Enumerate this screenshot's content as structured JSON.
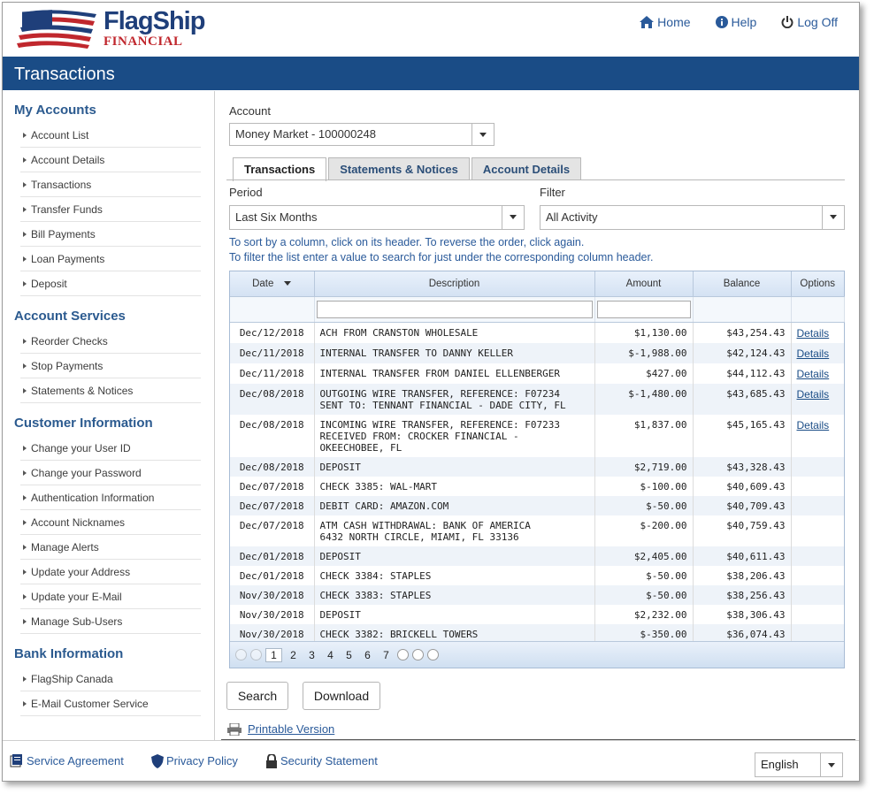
{
  "header": {
    "brand": "FlagShip",
    "brand_sub": "FINANCIAL",
    "nav": [
      {
        "label": "Home",
        "icon": "home-icon"
      },
      {
        "label": "Help",
        "icon": "info-icon"
      },
      {
        "label": "Log Off",
        "icon": "power-icon"
      }
    ]
  },
  "page_title": "Transactions",
  "sidebar": {
    "sections": [
      {
        "title": "My Accounts",
        "items": [
          "Account List",
          "Account Details",
          "Transactions",
          "Transfer Funds",
          "Bill Payments",
          "Loan Payments",
          "Deposit"
        ]
      },
      {
        "title": "Account Services",
        "items": [
          "Reorder Checks",
          "Stop Payments",
          "Statements & Notices"
        ]
      },
      {
        "title": "Customer Information",
        "items": [
          "Change your User ID",
          "Change your Password",
          "Authentication Information",
          "Account Nicknames",
          "Manage Alerts",
          "Update your Address",
          "Update your E-Mail",
          "Manage Sub-Users"
        ]
      },
      {
        "title": "Bank Information",
        "items": [
          "FlagShip Canada",
          "E-Mail Customer Service"
        ]
      }
    ]
  },
  "main": {
    "account_label": "Account",
    "account_value": "Money Market - 100000248",
    "tabs": [
      {
        "label": "Transactions",
        "active": true
      },
      {
        "label": "Statements & Notices",
        "active": false
      },
      {
        "label": "Account Details",
        "active": false
      }
    ],
    "period_label": "Period",
    "period_value": "Last Six Months",
    "filter_label": "Filter",
    "filter_value": "All Activity",
    "hint1": "To sort by a column, click on its header. To reverse the order, click again.",
    "hint2": "To filter the list enter a value to search for just under the corresponding column header.",
    "table": {
      "columns": [
        "Date",
        "Description",
        "Amount",
        "Balance",
        "Options"
      ],
      "rows": [
        {
          "date": "Dec/12/2018",
          "desc": "ACH FROM CRANSTON WHOLESALE",
          "amount": "$1,130.00",
          "balance": "$43,254.43",
          "option": "Details"
        },
        {
          "date": "Dec/11/2018",
          "desc": "INTERNAL TRANSFER TO DANNY KELLER",
          "amount": "$-1,988.00",
          "balance": "$42,124.43",
          "option": "Details"
        },
        {
          "date": "Dec/11/2018",
          "desc": "INTERNAL TRANSFER FROM DANIEL ELLENBERGER",
          "amount": "$427.00",
          "balance": "$44,112.43",
          "option": "Details"
        },
        {
          "date": "Dec/08/2018",
          "desc": "OUTGOING WIRE TRANSFER, REFERENCE: F07234\nSENT TO: TENNANT FINANCIAL - DADE CITY, FL",
          "amount": "$-1,480.00",
          "balance": "$43,685.43",
          "option": "Details"
        },
        {
          "date": "Dec/08/2018",
          "desc": "INCOMING WIRE TRANSFER, REFERENCE: F07233\nRECEIVED FROM: CROCKER FINANCIAL -\nOKEECHOBEE, FL",
          "amount": "$1,837.00",
          "balance": "$45,165.43",
          "option": "Details"
        },
        {
          "date": "Dec/08/2018",
          "desc": "DEPOSIT",
          "amount": "$2,719.00",
          "balance": "$43,328.43",
          "option": ""
        },
        {
          "date": "Dec/07/2018",
          "desc": "CHECK 3385: WAL-MART",
          "amount": "$-100.00",
          "balance": "$40,609.43",
          "option": ""
        },
        {
          "date": "Dec/07/2018",
          "desc": "DEBIT CARD: AMAZON.COM",
          "amount": "$-50.00",
          "balance": "$40,709.43",
          "option": ""
        },
        {
          "date": "Dec/07/2018",
          "desc": "ATM CASH WITHDRAWAL: BANK OF AMERICA\n6432 NORTH CIRCLE, MIAMI, FL 33136",
          "amount": "$-200.00",
          "balance": "$40,759.43",
          "option": ""
        },
        {
          "date": "Dec/01/2018",
          "desc": "DEPOSIT",
          "amount": "$2,405.00",
          "balance": "$40,611.43",
          "option": ""
        },
        {
          "date": "Dec/01/2018",
          "desc": "CHECK 3384: STAPLES",
          "amount": "$-50.00",
          "balance": "$38,206.43",
          "option": ""
        },
        {
          "date": "Nov/30/2018",
          "desc": "CHECK 3383: STAPLES",
          "amount": "$-50.00",
          "balance": "$38,256.43",
          "option": ""
        },
        {
          "date": "Nov/30/2018",
          "desc": "DEPOSIT",
          "amount": "$2,232.00",
          "balance": "$38,306.43",
          "option": ""
        },
        {
          "date": "Nov/30/2018",
          "desc": "CHECK 3382: BRICKELL TOWERS",
          "amount": "$-350.00",
          "balance": "$36,074.43",
          "option": ""
        }
      ]
    },
    "pager": {
      "pages": [
        "1",
        "2",
        "3",
        "4",
        "5",
        "6",
        "7"
      ],
      "current": "1"
    },
    "search_label": "Search",
    "download_label": "Download",
    "printable_label": "Printable Version"
  },
  "footer": {
    "links": [
      {
        "label": "Service Agreement",
        "icon": "document-icon"
      },
      {
        "label": "Privacy Policy",
        "icon": "shield-icon"
      },
      {
        "label": "Security Statement",
        "icon": "lock-icon"
      }
    ],
    "language": "English"
  },
  "colors": {
    "title_bar": "#1a4c86",
    "link": "#2a5a9a",
    "brand_blue": "#1f3f7a",
    "brand_red": "#c0272d"
  }
}
